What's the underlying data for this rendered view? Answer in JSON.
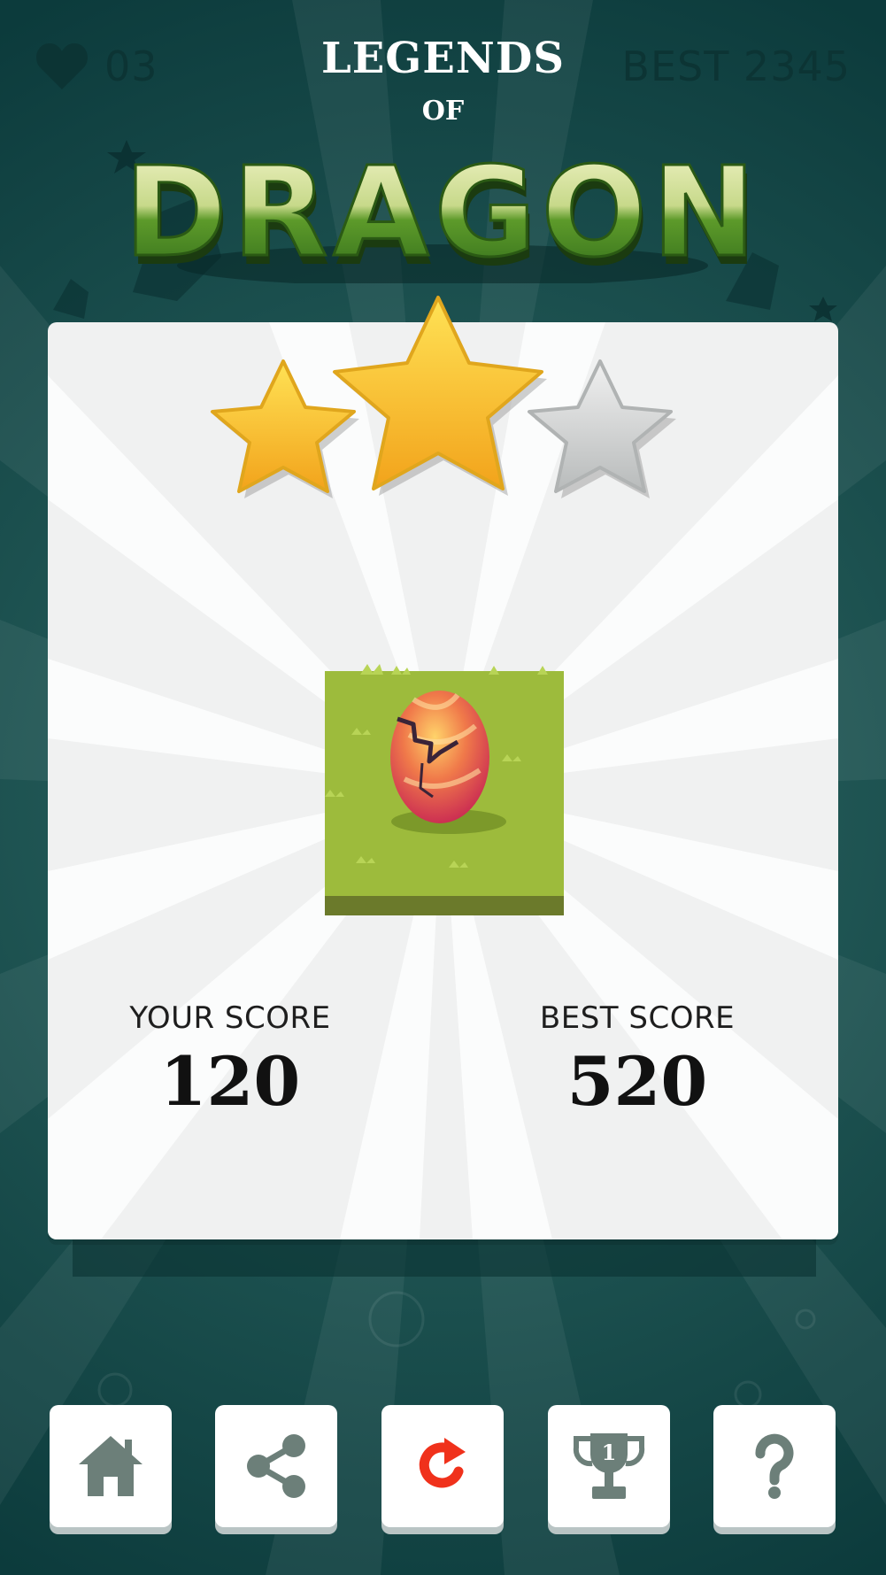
{
  "hud": {
    "lives": "03",
    "best": "BEST 2345"
  },
  "title": {
    "top": "LEGENDS",
    "middle": "OF",
    "main": "DRAGON"
  },
  "result": {
    "stars_earned": 2,
    "stars_total": 3,
    "your_score_label": "YOUR SCORE",
    "your_score": "120",
    "best_score_label": "BEST SCORE",
    "best_score": "520"
  },
  "toolbar": {
    "buttons": [
      {
        "name": "home",
        "icon": "home-icon"
      },
      {
        "name": "share",
        "icon": "share-icon"
      },
      {
        "name": "replay",
        "icon": "replay-icon"
      },
      {
        "name": "leaderboard",
        "icon": "trophy-icon",
        "badge": "1"
      },
      {
        "name": "help",
        "icon": "help-icon"
      }
    ]
  },
  "colors": {
    "background": "#0f3d3d",
    "panel": "#f0f1f1",
    "star_gold": "#f6c21c",
    "star_silver": "#cfd2d2",
    "icon_gray": "#6c7f79",
    "replay_red": "#f0311b",
    "grass": "#9dbb3c"
  }
}
